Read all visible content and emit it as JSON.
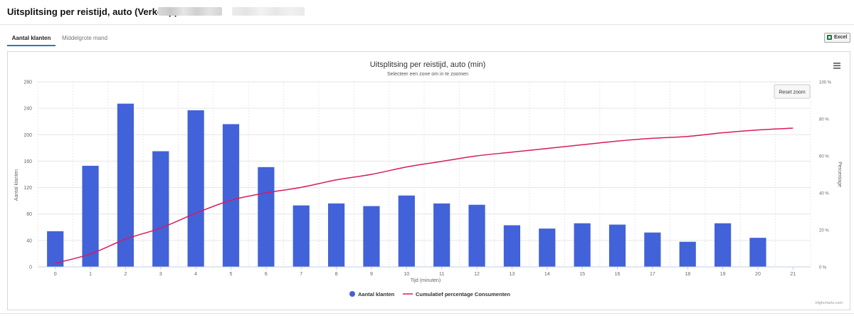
{
  "page": {
    "title": "Uitsplitsing per reistijd, auto (Verkooppunt:"
  },
  "tabs": [
    {
      "label": "Aantal klanten",
      "active": true
    },
    {
      "label": "Middelgrote mand",
      "active": false
    }
  ],
  "toolbar": {
    "excel_label": "Excel"
  },
  "chart": {
    "title": "Uitsplitsing per reistijd, auto (min)",
    "subtitle": "Selecteer een zone om in te zoomen",
    "reset_zoom_label": "Reset zoom",
    "credits": "Highcharts.com",
    "menu_icon": "hamburger-menu-icon"
  },
  "chart_data": {
    "type": "bar",
    "xlabel": "Tijd (minuten)",
    "ylabel": "Aantal klanten",
    "y2label": "Percentage",
    "ylim": [
      0,
      280
    ],
    "y2lim": [
      0,
      100
    ],
    "yticks": [
      0,
      40,
      80,
      120,
      160,
      200,
      240,
      280
    ],
    "y2ticks": [
      "0 %",
      "20 %",
      "40 %",
      "60 %",
      "80 %",
      "100 %"
    ],
    "xticks": [
      "0",
      "1",
      "2",
      "3",
      "4",
      "5",
      "6",
      "7",
      "8",
      "9",
      "10",
      "11",
      "12",
      "13",
      "14",
      "15",
      "16",
      "17",
      "18",
      "19",
      "20",
      "21"
    ],
    "grid": true,
    "legend_position": "bottom-center",
    "colors": {
      "bars": "#4262d9",
      "line": "#d81b60"
    },
    "series": [
      {
        "name": "Aantal klanten",
        "kind": "bar",
        "x": [
          0,
          1,
          2,
          3,
          4,
          5,
          6,
          7,
          8,
          9,
          10,
          11,
          12,
          13,
          14,
          15,
          16,
          17,
          18,
          19,
          20
        ],
        "values": [
          54,
          153,
          247,
          175,
          237,
          216,
          151,
          93,
          96,
          92,
          108,
          96,
          94,
          63,
          58,
          66,
          64,
          52,
          38,
          66,
          44
        ]
      },
      {
        "name": "Cumulatief percentage Consumenten",
        "kind": "line",
        "x": [
          0,
          1,
          2,
          3,
          4,
          5,
          6,
          7,
          8,
          9,
          10,
          11,
          12,
          13,
          14,
          15,
          16,
          17,
          18,
          19,
          20,
          21
        ],
        "values": [
          2,
          7,
          15,
          21,
          29,
          36,
          40,
          43,
          47,
          50,
          54,
          57,
          60,
          62,
          64,
          66,
          68,
          69.5,
          70.5,
          72.5,
          74,
          75
        ]
      }
    ]
  }
}
